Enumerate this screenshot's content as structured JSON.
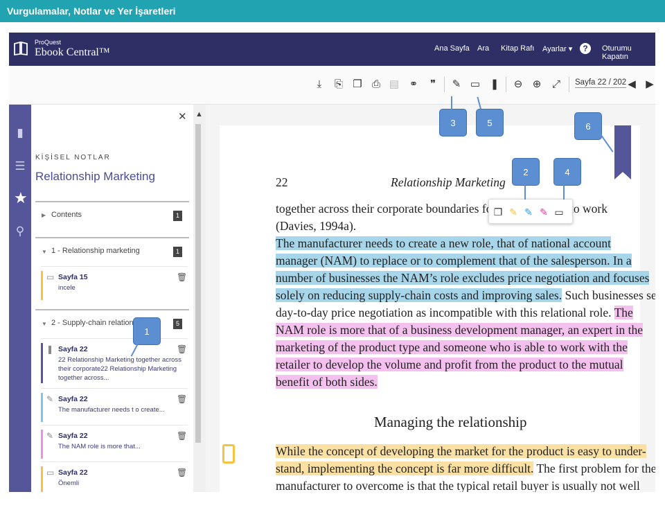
{
  "title_bar": "Vurgulamalar, Notlar ve Yer İşaretleri",
  "app": {
    "brand_small": "ProQuest",
    "brand_big": "Ebook Central™"
  },
  "nav": {
    "home": "Ana Sayfa",
    "search": "Ara",
    "bookshelf": "Kitap Rafı",
    "settings": "Ayarlar ▾",
    "logout": "Oturumu Kapatın"
  },
  "toolbar": {
    "page_indicator": "Sayfa 22 / 202"
  },
  "panel": {
    "heading": "KİŞİSEL NOTLAR",
    "book_title": "Relationship Marketing",
    "sections": [
      {
        "label": "Contents",
        "count": "1"
      },
      {
        "label": "1 - Relationship marketing",
        "count": "1"
      },
      {
        "label": "2 - Supply-chain relationships",
        "count": "5"
      }
    ],
    "notes": [
      {
        "page": "Sayfa 15",
        "text": "incele",
        "color": "#f5c242",
        "icon": "note-icon"
      },
      {
        "page": "Sayfa 22",
        "text": "22 Relationship Marketing together across their corporate22 Relationship Marketing together across...",
        "color": "#55569a",
        "icon": "bookmark-icon"
      },
      {
        "page": "Sayfa 22",
        "text": "The manufacturer needs t o create...",
        "color": "#7fc4e6",
        "icon": "highlighter-icon"
      },
      {
        "page": "Sayfa 22",
        "text": "The NAM role is more that...",
        "color": "#ee8fe6",
        "icon": "highlighter-icon"
      },
      {
        "page": "Sayfa 22",
        "text": "Önemli",
        "color": "#f5c242",
        "icon": "note-icon"
      }
    ]
  },
  "page": {
    "number": "22",
    "running_head": "Relationship Marketing",
    "heading": "Managing the relationship",
    "lines1": [
      {
        "t": "together across their corporate boundaries for th",
        "h": "",
        "tail": "to work"
      },
      {
        "t": "(Davies, 1994a).",
        "h": ""
      },
      {
        "t": "    The manufacturer needs to create a new role, that of national account",
        "h": "hb"
      },
      {
        "t": "manager (NAM) to replace or to complement that of the salesperson. In a",
        "h": "hb"
      },
      {
        "t": "number of businesses the NAM’s role excludes price negotiation and focuses",
        "h": "hb"
      }
    ],
    "line_mix_a": {
      "hl": "solely on reducing supply-chain costs and improving sales.",
      "rest": " Such businesses see"
    },
    "line_mix_b": {
      "rest": "day-to-day price negotiation as incompatible with this relational role. ",
      "hl": "The"
    },
    "lines2": [
      "NAM role is more that of a business development manager, an expert in the",
      "marketing of the product type and someone who is able to work with the",
      "retailer to develop the volume and profit from the product to the mutual",
      "benefit of both sides."
    ],
    "line_y1": "While the concept of developing the market for the product is easy to under-",
    "line_y2": {
      "hl": "stand, implementing the concept is far more difficult.",
      "rest": " The first problem for the"
    },
    "line_last": "manufacturer to overcome is that the typical retail buyer is usually not well"
  },
  "callouts": [
    "1",
    "2",
    "3",
    "4",
    "5",
    "6"
  ]
}
